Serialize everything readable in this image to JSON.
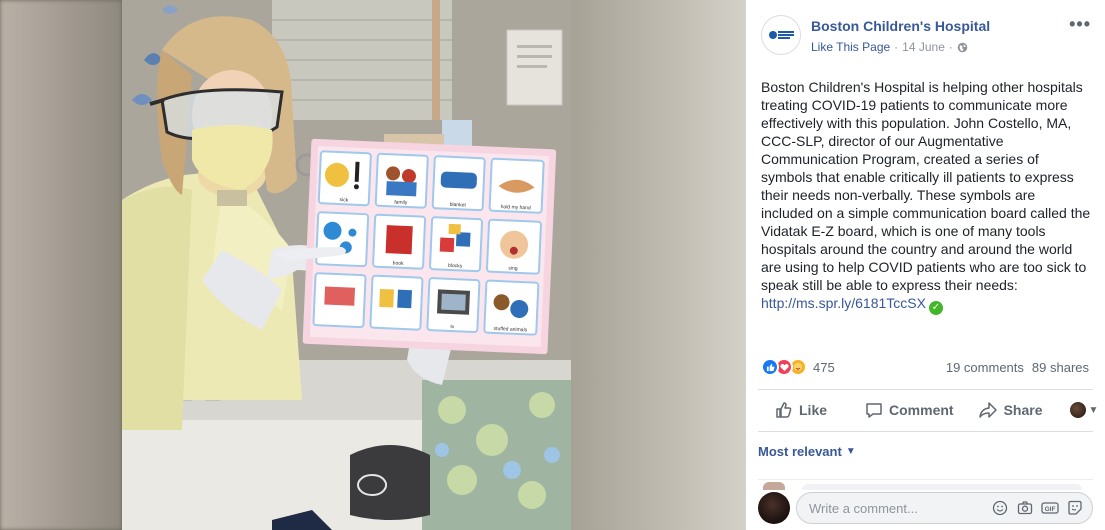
{
  "post": {
    "page_name": "Boston Children's Hospital",
    "page_logo_text": "Boston Children's Hospital",
    "like_page": "Like This Page",
    "date": "14 June",
    "separator": "·",
    "more": "•••",
    "text": "Boston Children's Hospital is helping other hospitals treating COVID-19 patients to communicate more effectively with this population. John Costello, MA, CCC-SLP, director of our Augmentative Communication Program, created a series of symbols that enable critically ill patients to express their needs non-verbally. These symbols are included on a simple communication board called the Vidatak E-Z board, which is one of many tools hospitals around the country and around the world are using to help COVID patients who are too sick to speak still be able to express their needs:",
    "link": "http://ms.spr.ly/6181TccSX",
    "verified_icon": "check-circle-icon"
  },
  "engagement": {
    "reaction_count": "475",
    "reactions": [
      "like",
      "love",
      "care"
    ],
    "comments": "19 comments",
    "shares": "89 shares"
  },
  "actions": {
    "like": "Like",
    "comment": "Comment",
    "share": "Share"
  },
  "comments": {
    "sort_label": "Most relevant",
    "input_placeholder": "Write a comment..."
  },
  "board": {
    "cells": [
      "sick",
      "family",
      "blanket",
      "hold my hand",
      "",
      "book",
      "blocks",
      "sing",
      "",
      "",
      "tv",
      "stuffed animals"
    ]
  },
  "colors": {
    "link": "#385898",
    "text": "#1d2129",
    "muted": "#90949c",
    "verified": "#42b72a",
    "board_border": "#f2b7c9"
  }
}
